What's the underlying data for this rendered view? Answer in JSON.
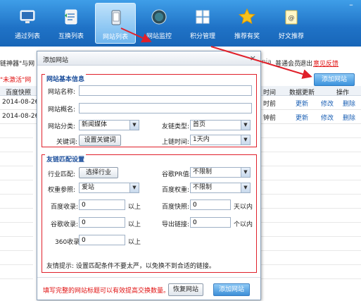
{
  "toolbar": {
    "items": [
      {
        "label": "通过列表",
        "icon": "monitor-icon"
      },
      {
        "label": "互换列表",
        "icon": "exchange-icon"
      },
      {
        "label": "网站列表",
        "icon": "phone-icon"
      },
      {
        "label": "网站监控",
        "icon": "globe-icon"
      },
      {
        "label": "积分管理",
        "icon": "grid-icon"
      },
      {
        "label": "推荐有奖",
        "icon": "star-icon"
      },
      {
        "label": "好文推荐",
        "icon": "notepad-icon"
      }
    ],
    "minimize": "–"
  },
  "background": {
    "app_title_fragment": "链神器\"与网",
    "user_fragment": "nia",
    "member_type": "普通会员",
    "logout": "退出",
    "feedback": "意见反馈",
    "red_notice": "\"未激活\"网",
    "add_site_button": "添加网站",
    "columns": {
      "baidu_snapshot": "百度快照",
      "time": "时间",
      "data_update": "数据更新",
      "actions": "操作"
    },
    "rows": [
      {
        "snapshot": "2014-08-26",
        "time": "时前",
        "update": "更新",
        "edit": "修改",
        "delete": "删除"
      },
      {
        "snapshot": "2014-08-26",
        "time": "钟前",
        "update": "更新",
        "edit": "修改",
        "delete": "删除"
      }
    ]
  },
  "dialog": {
    "title": "添加网站",
    "close": "×",
    "basic": {
      "title": "网站基本信息",
      "site_name_label": "网站名称:",
      "site_name_value": "",
      "site_alias_label": "网站概名:",
      "site_alias_value": "",
      "category_label": "网站分类:",
      "category_value": "新闻媒体",
      "friend_type_label": "友链类型:",
      "friend_type_value": "首页",
      "keyword_label": "关键词:",
      "keyword_button": "设置关键词",
      "link_time_label": "上链时间:",
      "link_time_value": "1天内"
    },
    "match": {
      "title": "友链匹配设置",
      "industry_label": "行业匹配:",
      "industry_button": "选择行业",
      "google_pr_label": "谷歌PR值:",
      "google_pr_value": "不限制",
      "weight_ref_label": "权重参照:",
      "weight_ref_value": "爱站",
      "baidu_weight_label": "百度权重:",
      "baidu_weight_value": "不限制",
      "baidu_index_label": "百度收录:",
      "baidu_index_value": "0",
      "baidu_index_suffix": "以上",
      "baidu_snapshot_label": "百度快照:",
      "baidu_snapshot_value": "0",
      "baidu_snapshot_suffix": "天以内",
      "google_index_label": "谷歌收录:",
      "google_index_value": "0",
      "google_index_suffix": "以上",
      "outbound_label": "导出链接:",
      "outbound_value": "0",
      "outbound_suffix": "个以内",
      "s360_label": "360收录:",
      "s360_value": "0",
      "s360_suffix": "以上",
      "hint": "友情提示: 设置匹配条件不要太严，以免换不到合适的链接。"
    },
    "footer": {
      "warning": "填写完整的网站标题可以有效提高交换数量。",
      "restore_button": "恢复网站",
      "add_button": "添加网站"
    }
  }
}
